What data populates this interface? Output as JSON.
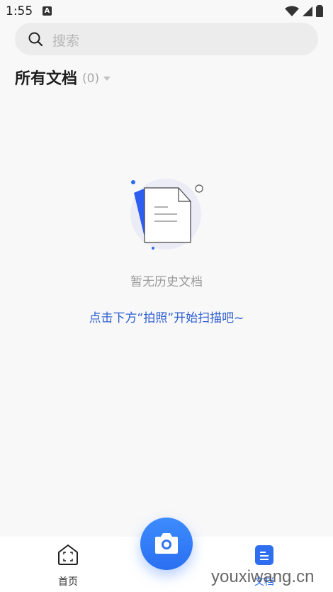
{
  "status_bar": {
    "time": "1:55",
    "notification_letter": "A"
  },
  "search": {
    "placeholder": "搜索"
  },
  "documents": {
    "title": "所有文档",
    "count": "(0)"
  },
  "empty_state": {
    "message": "暂无历史文档",
    "hint": "点击下方“拍照”开始扫描吧~"
  },
  "bottom_nav": {
    "home_label": "首页",
    "docs_label": "文档"
  },
  "watermark": {
    "text": "youxiwang.cn"
  },
  "colors": {
    "accent": "#2f6fef",
    "hint": "#2f5fd0",
    "background": "#f8f8f9"
  }
}
